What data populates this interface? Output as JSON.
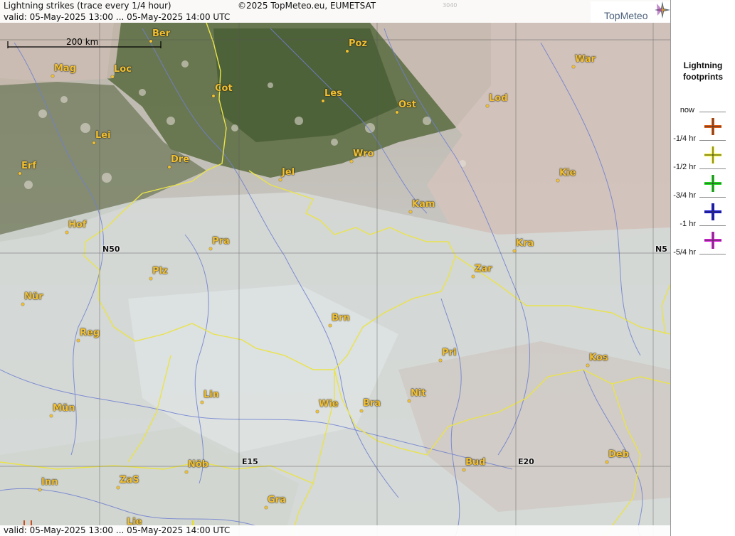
{
  "header": {
    "title": "Lightning strikes (trace every 1/4 hour)",
    "copyright": "©2025 TopMeteo.eu, EUMETSAT",
    "code": "3040",
    "valid_top": "valid:  05-May-2025 13:00 ... 05-May-2025 14:00 UTC",
    "valid_bottom": "valid:  05-May-2025 13:00 ... 05-May-2025 14:00 UTC"
  },
  "logo": {
    "text": "TopMeteo",
    "icon": "compass-star-icon"
  },
  "scale": {
    "label": "200 km"
  },
  "grid_labels": {
    "lat": "N50",
    "lat_right": "N5",
    "lon1": "E15",
    "lon2": "E20"
  },
  "cities": [
    {
      "label": "Ber"
    },
    {
      "label": "Poz"
    },
    {
      "label": "War"
    },
    {
      "label": "Mag"
    },
    {
      "label": "Loc"
    },
    {
      "label": "Cot"
    },
    {
      "label": "Les"
    },
    {
      "label": "Ost"
    },
    {
      "label": "Lod"
    },
    {
      "label": "Lei"
    },
    {
      "label": "Wro"
    },
    {
      "label": "Erf"
    },
    {
      "label": "Dre"
    },
    {
      "label": "Jel"
    },
    {
      "label": "Kie"
    },
    {
      "label": "Kam"
    },
    {
      "label": "Hof"
    },
    {
      "label": "Pra"
    },
    {
      "label": "Kra"
    },
    {
      "label": "Plz"
    },
    {
      "label": "Zar"
    },
    {
      "label": "Nür"
    },
    {
      "label": "Brn"
    },
    {
      "label": "Reg"
    },
    {
      "label": "Pri"
    },
    {
      "label": "Kos"
    },
    {
      "label": "Lin"
    },
    {
      "label": "Nit"
    },
    {
      "label": "Bra"
    },
    {
      "label": "Wie"
    },
    {
      "label": "Mün"
    },
    {
      "label": "Bud"
    },
    {
      "label": "Deb"
    },
    {
      "label": "Nöb"
    },
    {
      "label": "ZaS"
    },
    {
      "label": "Inn"
    },
    {
      "label": "Gra"
    },
    {
      "label": "Lie"
    }
  ],
  "legend": {
    "title_line1": "Lightning",
    "title_line2": "footprints",
    "items": [
      {
        "label": "now",
        "color": "#e05a10",
        "icon": "plus-orange-icon"
      },
      {
        "label": "-1/4 hr",
        "color": "#f0f020",
        "icon": "plus-yellow-icon"
      },
      {
        "label": "-1/2 hr",
        "color": "#20e020",
        "icon": "plus-green-icon"
      },
      {
        "label": "-3/4 hr",
        "color": "#1010e0",
        "icon": "plus-blue-icon"
      },
      {
        "label": "-1 hr",
        "color": "#e020e0",
        "icon": "plus-magenta-icon"
      },
      {
        "label": "-5/4 hr"
      }
    ]
  },
  "strikes": [
    {
      "age": "now",
      "color": "#c85020"
    },
    {
      "age": "-1/4 hr",
      "color": "#e8e020"
    }
  ]
}
